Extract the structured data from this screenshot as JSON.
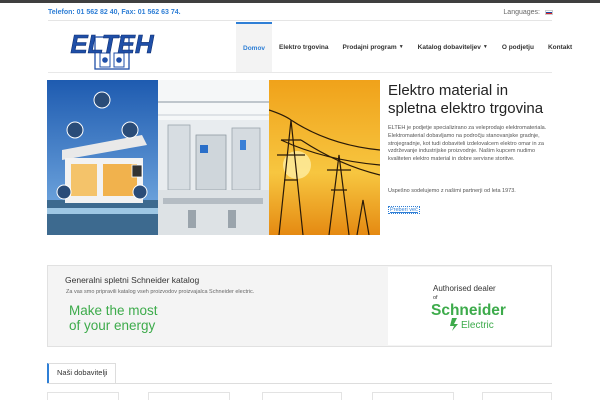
{
  "topbar": {
    "phone_fax": "Telefon: 01 562 82 40, Fax: 01 562 63 74.",
    "languages_label": "Languages:"
  },
  "logo": {
    "text": "ELTEH"
  },
  "nav": {
    "items": [
      {
        "label": "Domov",
        "active": true,
        "dropdown": false
      },
      {
        "label": "Elektro trgovina",
        "active": false,
        "dropdown": false
      },
      {
        "label": "Prodajni program",
        "active": false,
        "dropdown": true
      },
      {
        "label": "Katalog dobaviteljev",
        "active": false,
        "dropdown": true
      },
      {
        "label": "O podjetju",
        "active": false,
        "dropdown": false
      },
      {
        "label": "Kontakt",
        "active": false,
        "dropdown": false
      }
    ]
  },
  "hero": {
    "title": "Elektro material in spletna elektro trgovina",
    "paragraph": "ELTEH je podjetje specializirano za veleprodajo elektromateriala. Elektromaterial dobavljamo na področju stanovanjske gradnje, strojegradnje, kot tudi dobaviteli izdelovalcem elektro omar in za vzdrževanje industrijske proizvodnje. Našim kupcem nudimo kvaliteten elektro material in dobre servisne storitve.",
    "since": "Uspešno sodelujemo z našimi partnerji od leta 1973.",
    "more_link": "Preberi več"
  },
  "banner": {
    "title": "Generalni spletni Schneider katalog",
    "description": "Za vas smo pripravili katalog vseh proizvodov proizvajalca Schneider electric.",
    "slogan_line1": "Make the most",
    "slogan_line2": "of your energy",
    "partner_auth": "Authorised dealer",
    "partner_of": "of",
    "partner_logo_line1": "Schneider",
    "partner_logo_line2": "Electric"
  },
  "suppliers": {
    "title": "Naši dobavitelji"
  },
  "colors": {
    "accent": "#2f7fd6",
    "schneider_green": "#3dab4b",
    "logo_blue": "#1f4fa8"
  }
}
